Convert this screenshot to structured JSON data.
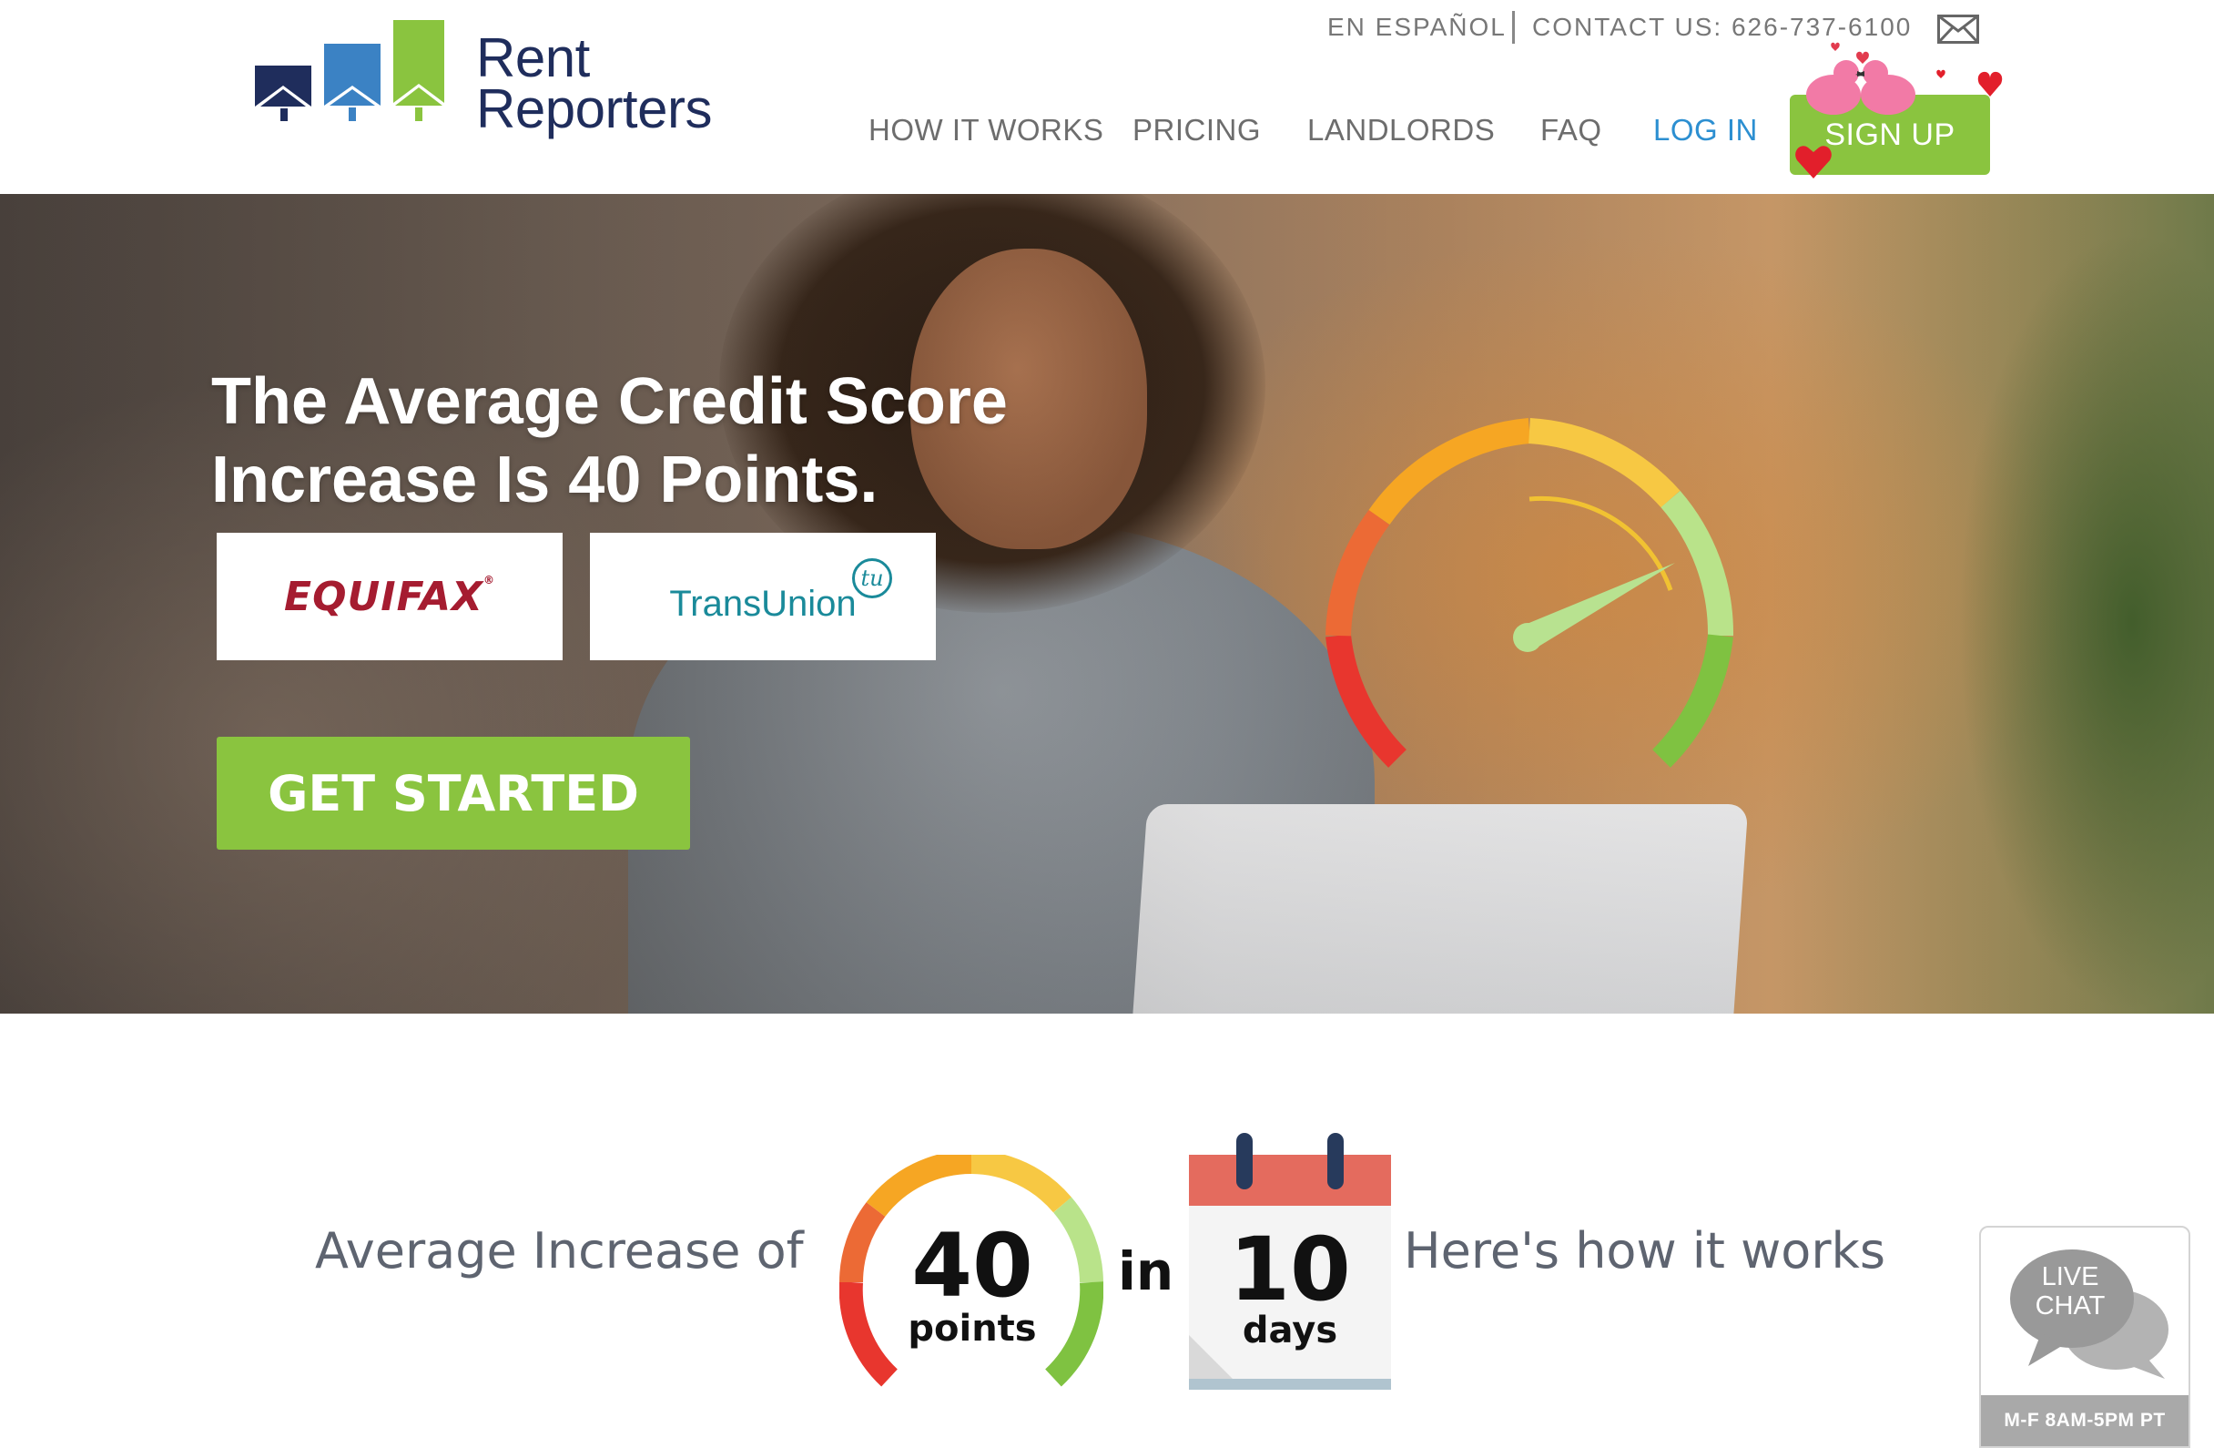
{
  "brand": {
    "name_line1": "Rent",
    "name_line2": "Reporters",
    "colors": {
      "navy": "#1f2d5c",
      "blue": "#3b82c4",
      "green": "#8ac43f"
    }
  },
  "utility": {
    "espanol": "EN ESPAÑOL",
    "contact": "CONTACT US: 626-737-6100",
    "mail_icon": "envelope-icon"
  },
  "nav": {
    "items": [
      {
        "label": "HOW IT WORKS"
      },
      {
        "label": "PRICING"
      },
      {
        "label": "LANDLORDS"
      },
      {
        "label": "FAQ"
      }
    ],
    "login": "LOG IN",
    "signup": "SIGN UP"
  },
  "hero": {
    "title_line1": "The Average Credit Score",
    "title_line2": "Increase Is 40 Points.",
    "bureaus": {
      "equifax": "EQUIFAX",
      "transunion": "TransUnion",
      "transunion_badge": "tu"
    },
    "cta": "GET STARTED",
    "gauge_icon": "credit-score-gauge-icon"
  },
  "stats": {
    "prefix": "Average Increase of",
    "points_value": "40",
    "points_unit": "points",
    "connector": "in",
    "days_value": "10",
    "days_unit": "days",
    "link": "Here's how it works"
  },
  "live_chat": {
    "line1": "LIVE",
    "line2": "CHAT",
    "hours": "M-F 8AM-5PM PT"
  },
  "colors": {
    "accent_green": "#8ac43f",
    "link_blue": "#2c8fd1",
    "nav_gray": "#6d6d6d",
    "equifax_red": "#a51c30",
    "transunion_teal": "#1a8a9a"
  }
}
